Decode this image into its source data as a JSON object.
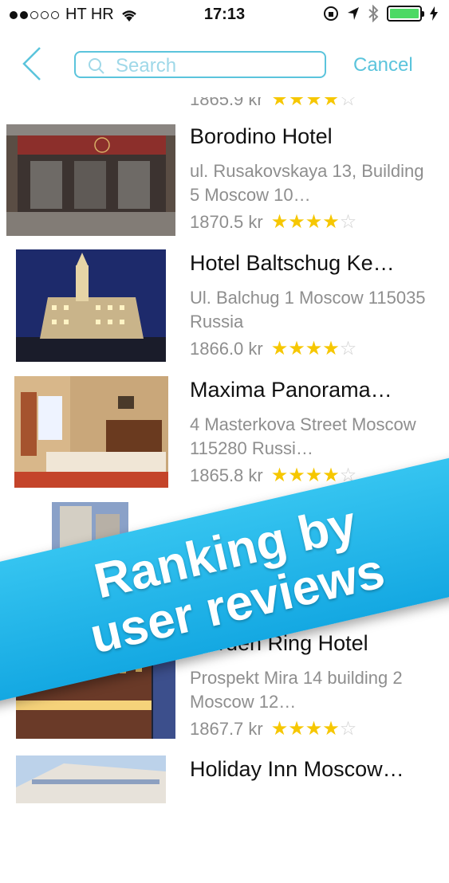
{
  "status": {
    "carrier": "HT HR",
    "time": "17:13",
    "battery_level": 1.0
  },
  "nav": {
    "search_placeholder": "Search",
    "cancel_label": "Cancel"
  },
  "top_partial": {
    "price": "1865.9 kr",
    "rating": 4
  },
  "hotels": [
    {
      "name": "Borodino Hotel",
      "address": "ul. Rusakovskaya 13, Building 5 Moscow  10…",
      "price": "1870.5 kr",
      "rating": 4
    },
    {
      "name": "Hotel Baltschug Ke…",
      "address": "Ul. Balchug 1 Moscow 115035 Russia",
      "price": "1866.0 kr",
      "rating": 4
    },
    {
      "name": "Maxima Panorama…",
      "address": "4 Masterkova Street Moscow  115280 Russi…",
      "price": "1865.8 kr",
      "rating": 4
    },
    {
      "name": "Garden Ring Hotel",
      "address": "Prospekt Mira 14 building 2 Moscow  12…",
      "price": "1867.7 kr",
      "rating": 4
    },
    {
      "name": "Holiday Inn Moscow…",
      "address": "",
      "price": "",
      "rating": 0
    }
  ],
  "banner": {
    "line1": "Ranking by",
    "line2": "user reviews"
  },
  "colors": {
    "accent": "#5bc4dc",
    "star": "#f6c700",
    "banner": "#1eb3ea"
  }
}
